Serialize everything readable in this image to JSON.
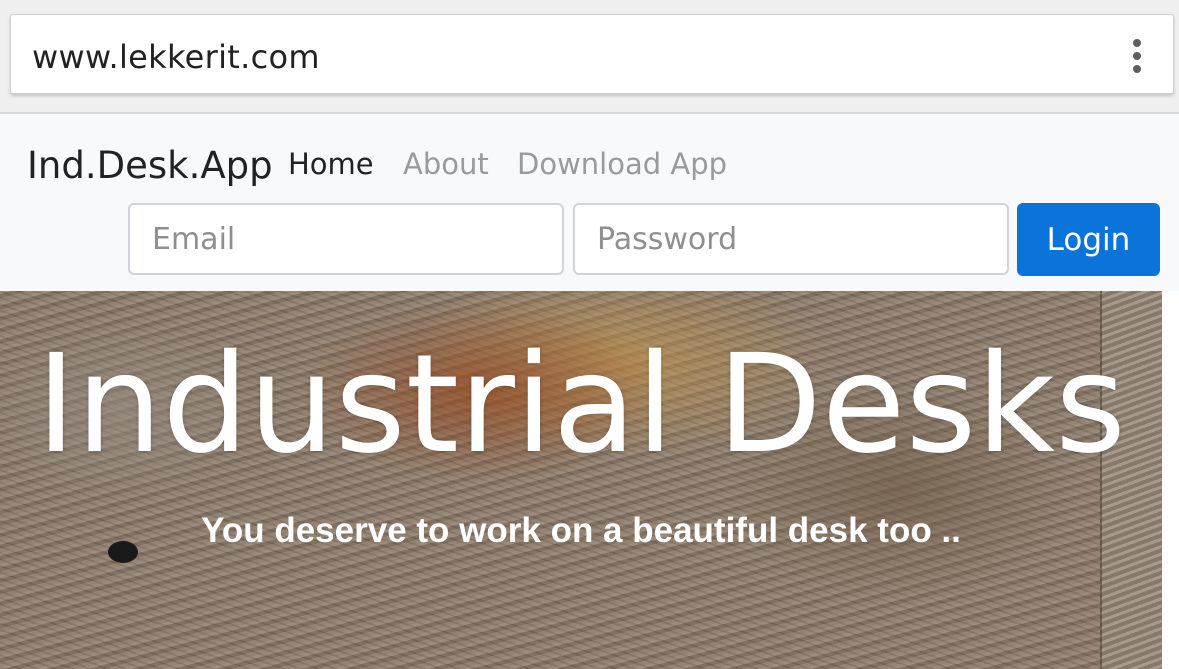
{
  "browser": {
    "url": "www.lekkerit.com",
    "menu_icon": "kebab-menu-icon"
  },
  "navbar": {
    "brand": "Ind.Desk.App",
    "links": [
      {
        "label": "Home",
        "active": true
      },
      {
        "label": "About",
        "active": false
      },
      {
        "label": "Download App",
        "active": false
      }
    ],
    "email_placeholder": "Email",
    "password_placeholder": "Password",
    "login_label": "Login"
  },
  "hero": {
    "title": "Industrial Desks",
    "subtitle": "You deserve to work on a beautiful desk too .."
  },
  "colors": {
    "accent": "#0a74da",
    "navbar_bg": "#f8f9fa",
    "muted_link": "#9a9a9a"
  }
}
